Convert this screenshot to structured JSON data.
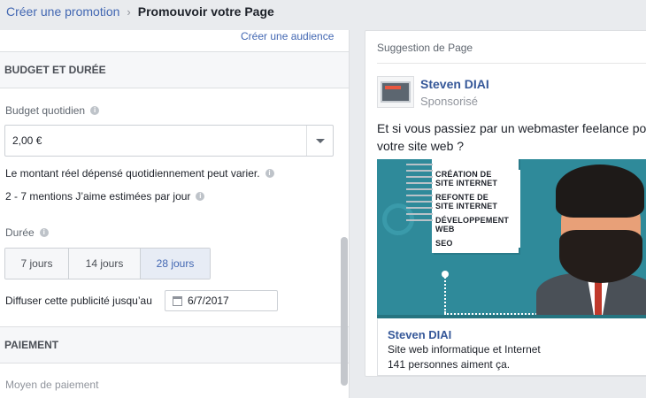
{
  "breadcrumb": {
    "parent": "Créer une promotion",
    "separator": "›",
    "current": "Promouvoir votre Page"
  },
  "left": {
    "create_audience_link": "Créer une audience",
    "budget_section": {
      "title": "BUDGET ET DURÉE",
      "daily_budget_label": "Budget quotidien",
      "daily_budget_value": "2,00 €",
      "spend_note": "Le montant réel dépensé quotidiennement peut varier.",
      "likes_estimate": "2 - 7 mentions J’aime estimées par jour",
      "duration_label": "Durée",
      "duration_options": [
        {
          "label": "7 jours",
          "selected": false
        },
        {
          "label": "14 jours",
          "selected": false
        },
        {
          "label": "28 jours",
          "selected": true
        }
      ],
      "end_date_label": "Diffuser cette publicité jusqu’au",
      "end_date_value": "6/7/2017"
    },
    "payment_section": {
      "title": "PAIEMENT",
      "method_label": "Moyen de paiement"
    }
  },
  "preview": {
    "header": "Suggestion de Page",
    "page_name": "Steven DIAI",
    "sponsored": "Sponsorisé",
    "post_text": "Et si vous passiez par un webmaster feelance pour votre site web ?",
    "image_text": {
      "line1": "CRÉATION DE",
      "line2": "SITE INTERNET",
      "line3": "REFONTE DE",
      "line4": "SITE INTERNET",
      "line5": "DÉVELOPPEMENT",
      "line6": "WEB",
      "line7": "SEO"
    },
    "link_title": "Steven DIAI",
    "link_description": "Site web informatique et Internet",
    "link_likes": "141 personnes aiment ça."
  },
  "colors": {
    "accent": "#4267b2",
    "link": "#365899",
    "image_bg": "#2f8a9a"
  },
  "icons": {
    "info": "info-icon",
    "dropdown": "chevron-down-icon",
    "calendar": "calendar-icon"
  }
}
